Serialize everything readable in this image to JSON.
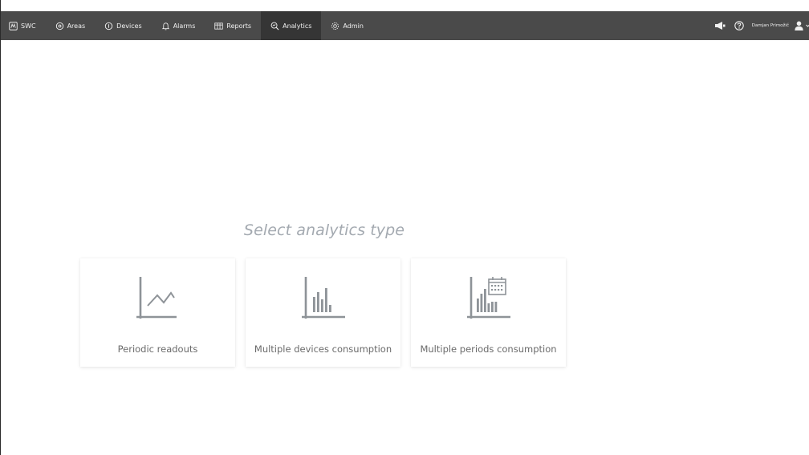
{
  "nav": {
    "items": [
      {
        "label": "SWC",
        "icon": "logo-icon",
        "active": false
      },
      {
        "label": "Areas",
        "icon": "location-pin-icon",
        "active": false
      },
      {
        "label": "Devices",
        "icon": "device-icon",
        "active": false
      },
      {
        "label": "Alarms",
        "icon": "bell-icon",
        "active": false
      },
      {
        "label": "Reports",
        "icon": "table-icon",
        "active": false
      },
      {
        "label": "Analytics",
        "icon": "search-chart-icon",
        "active": true
      },
      {
        "label": "Admin",
        "icon": "gear-icon",
        "active": false
      }
    ],
    "bar_color": "#4a4a4a",
    "active_color": "#353535"
  },
  "header": {
    "user_name": "Damjan Primožič",
    "icons": [
      "megaphone-icon",
      "help-icon",
      "user-icon",
      "chevron-down-icon"
    ]
  },
  "main": {
    "title": "Select analytics type",
    "cards": [
      {
        "label": "Periodic readouts",
        "icon": "line-chart-icon"
      },
      {
        "label": "Multiple devices consumption",
        "icon": "bar-chart-icon"
      },
      {
        "label": "Multiple periods consumption",
        "icon": "bar-calendar-chart-icon"
      }
    ]
  }
}
